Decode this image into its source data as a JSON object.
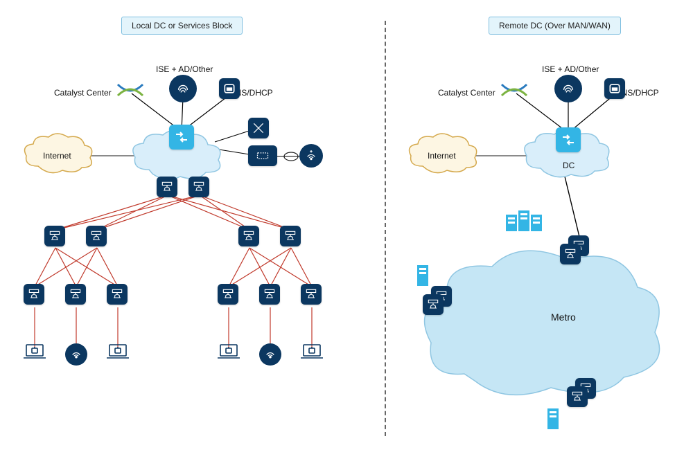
{
  "left": {
    "title": "Local DC or Services Block",
    "labels": {
      "catalyst_center": "Catalyst Center",
      "ise": "ISE + AD/Other",
      "dns": "DNS/DHCP",
      "internet": "Internet"
    }
  },
  "right": {
    "title": "Remote DC (Over MAN/WAN)",
    "labels": {
      "catalyst_center": "Catalyst Center",
      "ise": "ISE + AD/Other",
      "dns": "DNS/DHCP",
      "internet": "Internet",
      "dc": "DC",
      "metro": "Metro"
    }
  }
}
